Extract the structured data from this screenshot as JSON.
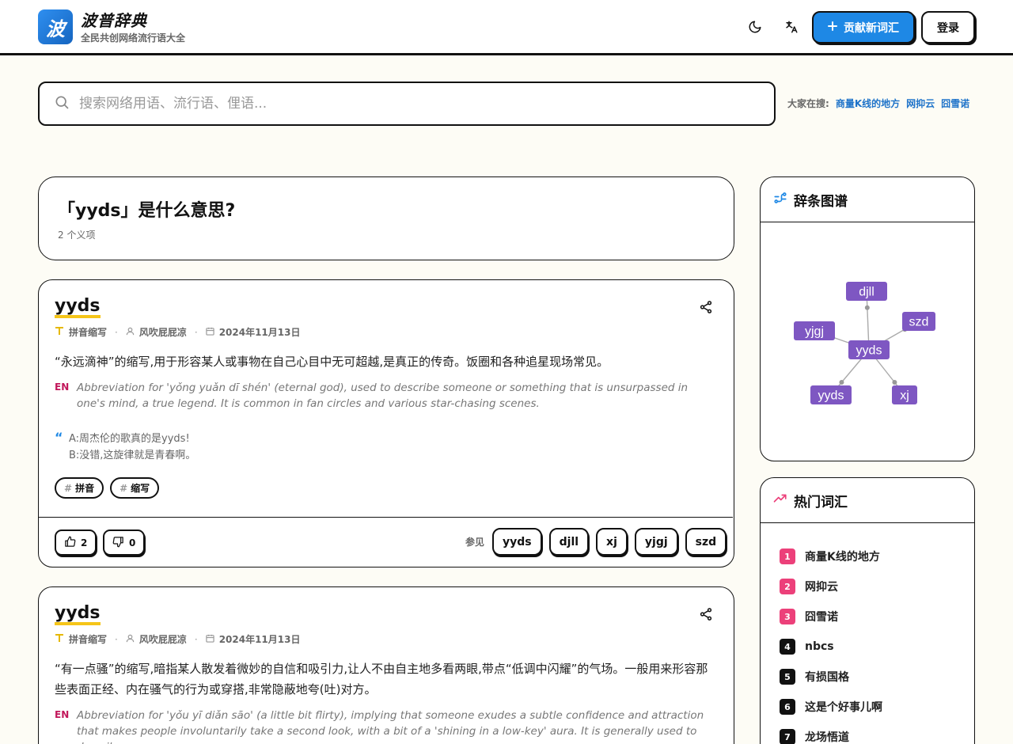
{
  "brand": {
    "logo_glyph": "波",
    "name": "波普辞典",
    "tagline": "全民共创网络流行语大全"
  },
  "header": {
    "contribute_label": "贡献新词汇",
    "login_label": "登录"
  },
  "search": {
    "placeholder": "搜索网络用语、流行语、俚语...",
    "hot_label": "大家在搜:",
    "hot_terms": [
      "商量K线的地方",
      "网抑云",
      "囧雪诺"
    ]
  },
  "title_card": {
    "title": "「yyds」是什么意思?",
    "count": "2 个义项"
  },
  "entries": [
    {
      "word": "yyds",
      "type": "拼音缩写",
      "author": "风吹屁屁凉",
      "date": "2024年11月13日",
      "definition": "“永远滴神”的缩写,用于形容某人或事物在自己心目中无可超越,是真正的传奇。饭圈和各种追星现场常见。",
      "en_tag": "EN",
      "en_definition": "Abbreviation for 'yǒng yuǎn dī shén' (eternal god), used to describe someone or something that is unsurpassed in one's mind, a true legend. It is common in fan circles and various star-chasing scenes.",
      "example_lines": [
        "A:周杰伦的歌真的是yyds!",
        "B:没错,这旋律就是青春啊。"
      ],
      "tags": [
        "拼音",
        "缩写"
      ],
      "upvotes": "2",
      "downvotes": "0",
      "see_also_label": "参见",
      "see_also": [
        "yyds",
        "djll",
        "xj",
        "yjgj",
        "szd"
      ]
    },
    {
      "word": "yyds",
      "type": "拼音缩写",
      "author": "风吹屁屁凉",
      "date": "2024年11月13日",
      "definition": "“有一点骚”的缩写,暗指某人散发着微妙的自信和吸引力,让人不由自主地多看两眼,带点“低调中闪耀”的气场。一般用来形容那些表面正经、内在骚气的行为或穿搭,非常隐蔽地夸(吐)对方。",
      "en_tag": "EN",
      "en_definition": "Abbreviation for 'yǒu yī diǎn sāo' (a little bit flirty), implying that someone exudes a subtle confidence and attraction that makes people involuntarily take a second look, with a bit of a 'shining in a low-key' aura. It is generally used to describe"
    }
  ],
  "graph_panel": {
    "title": "辞条图谱",
    "center": "yyds",
    "nodes": [
      "djll",
      "szd",
      "yjgj",
      "yyds",
      "xj"
    ],
    "node_color": "#7e57c2"
  },
  "trend_panel": {
    "title": "热门词汇",
    "items": [
      {
        "rank": "1",
        "word": "商量K线的地方",
        "color": "#ec407a"
      },
      {
        "rank": "2",
        "word": "网抑云",
        "color": "#ec407a"
      },
      {
        "rank": "3",
        "word": "囧雪诺",
        "color": "#ec407a"
      },
      {
        "rank": "4",
        "word": "nbcs",
        "color": "#111111"
      },
      {
        "rank": "5",
        "word": "有损国格",
        "color": "#111111"
      },
      {
        "rank": "6",
        "word": "这是个好事儿啊",
        "color": "#111111"
      },
      {
        "rank": "7",
        "word": "龙场悟道",
        "color": "#111111"
      }
    ]
  }
}
